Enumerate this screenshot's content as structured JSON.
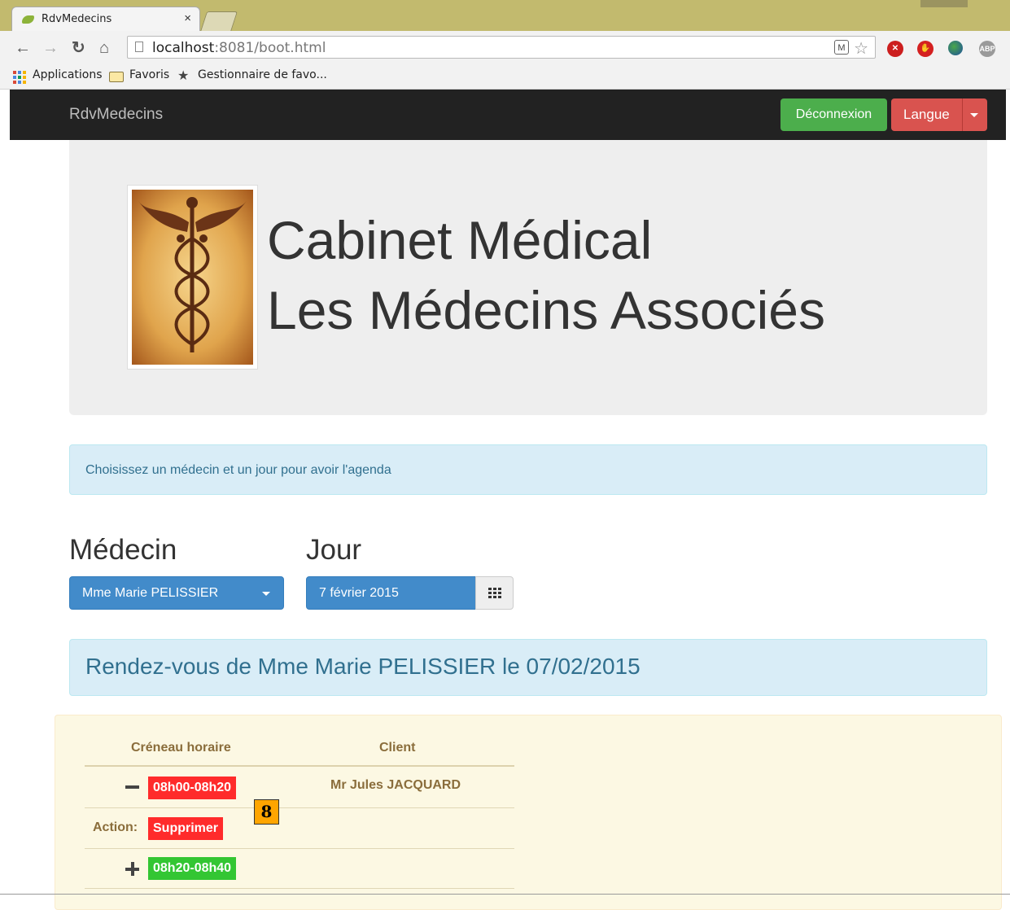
{
  "browser": {
    "tab_title": "RdvMedecins",
    "tab_close": "×",
    "url_host": "localhost",
    "url_rest": ":8081/boot.html",
    "bookmarks": {
      "apps": "Applications",
      "favoris": "Favoris",
      "manager": "Gestionnaire de favo..."
    },
    "extensions": [
      "adblock-red-icon",
      "stop-icon",
      "globe-icon",
      "abp-icon"
    ],
    "ext_abp_label": "ABP"
  },
  "navbar": {
    "brand": "RdvMedecins",
    "logout_label": "Déconnexion",
    "language_label": "Langue"
  },
  "jumbotron": {
    "line1": "Cabinet Médical",
    "line2": "Les Médecins Associés"
  },
  "info_message": "Choisissez un médecin et un jour pour avoir l'agenda",
  "selectors": {
    "doctor_label": "Médecin",
    "doctor_value": "Mme Marie PELISSIER",
    "day_label": "Jour",
    "day_value": "7 février 2015"
  },
  "agenda": {
    "title": "Rendez-vous de Mme Marie PELISSIER le 07/02/2015",
    "columns": [
      "Créneau horaire",
      "Client"
    ],
    "rows": [
      {
        "slot": "08h00-08h20",
        "client": "Mr Jules JACQUARD",
        "status": "booked"
      },
      {
        "action_label": "Action:",
        "action_button": "Supprimer"
      },
      {
        "slot": "08h20-08h40",
        "client": "",
        "status": "free"
      }
    ],
    "step_marker": "8"
  },
  "colors": {
    "navbar_bg": "#222222",
    "success": "#4cae4c",
    "danger": "#d9534f",
    "primary": "#428bca",
    "info_bg": "#d9edf7",
    "warning_bg": "#fcf8e3",
    "slot_booked": "#ff2b2b",
    "slot_free": "#33c633",
    "marker": "#ffa500"
  }
}
